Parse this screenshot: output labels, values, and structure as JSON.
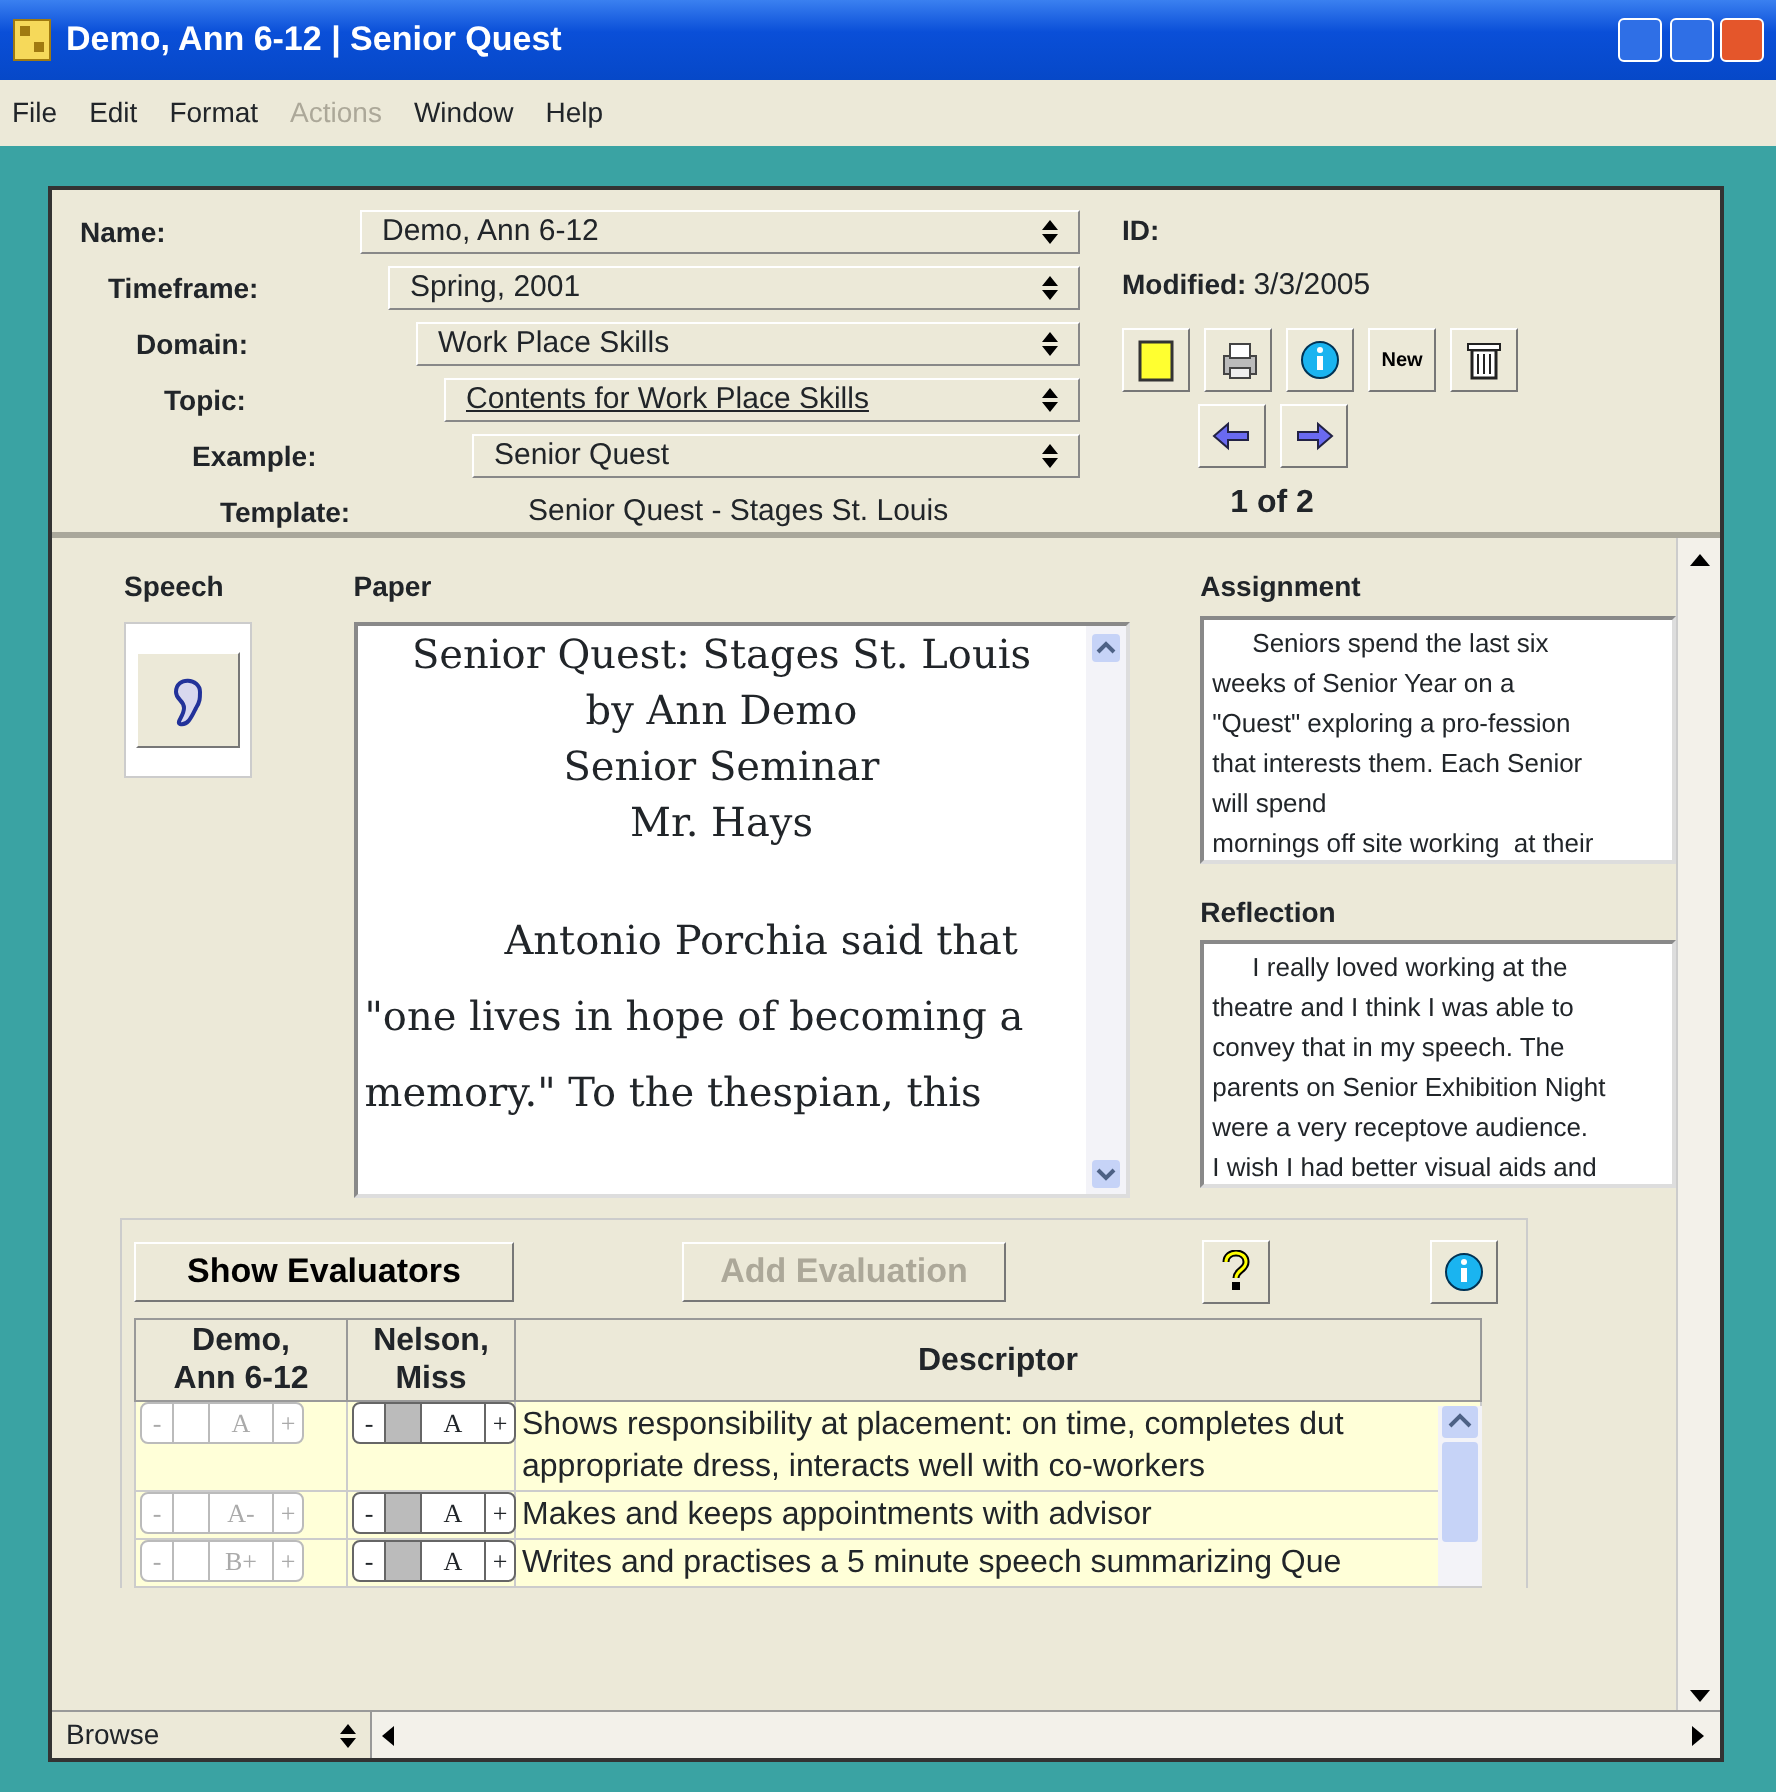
{
  "window": {
    "title": "Demo, Ann 6-12 | Senior Quest"
  },
  "menu": [
    {
      "label": "File",
      "disabled": false
    },
    {
      "label": "Edit",
      "disabled": false
    },
    {
      "label": "Format",
      "disabled": false
    },
    {
      "label": "Actions",
      "disabled": true
    },
    {
      "label": "Window",
      "disabled": false
    },
    {
      "label": "Help",
      "disabled": false
    }
  ],
  "fields": [
    {
      "label": "Name:",
      "value": "Demo, Ann 6-12",
      "kind": "select",
      "underlined": false
    },
    {
      "label": "Timeframe:",
      "value": "Spring, 2001",
      "kind": "select",
      "underlined": false
    },
    {
      "label": "Domain:",
      "value": "Work Place Skills",
      "kind": "select",
      "underlined": false
    },
    {
      "label": "Topic:",
      "value": "Contents for Work Place Skills",
      "kind": "select",
      "underlined": true
    },
    {
      "label": "Example:",
      "value": "Senior Quest",
      "kind": "select",
      "underlined": false
    },
    {
      "label": "Template:",
      "value": "Senior Quest - Stages St. Louis",
      "kind": "text",
      "underlined": false
    }
  ],
  "id": {
    "label": "ID:"
  },
  "modified": {
    "label": "Modified:",
    "value": "3/3/2005"
  },
  "toolbar": [
    {
      "kind": "notebook"
    },
    {
      "kind": "printer"
    },
    {
      "kind": "info"
    },
    {
      "kind": "text",
      "label": "New"
    },
    {
      "kind": "trash"
    }
  ],
  "record_counter": "1 of 2",
  "speech": {
    "label": "Speech"
  },
  "paper": {
    "label": "Paper",
    "heading": [
      "Senior Quest: Stages St. Louis",
      "by Ann Demo",
      "Senior Seminar",
      "Mr. Hays"
    ],
    "body": [
      "Antonio Porchia said that",
      "\"one lives in hope of becoming a",
      "memory.\" To the thespian, this"
    ]
  },
  "assignment": {
    "label": "Assignment",
    "lines": [
      "Seniors spend the last six",
      "weeks of Senior Year on a",
      "\"Quest\" exploring a pro-fession",
      "that interests them. Each Senior",
      "will spend",
      "mornings off site working  at their"
    ]
  },
  "reflection": {
    "label": "Reflection",
    "lines": [
      "I really loved working at the",
      "theatre and I think I was able to",
      "convey that in my speech. The",
      "parents on Senior Exhibition Night",
      "were a very receptove audience.",
      "I wish I had better visual aids and"
    ]
  },
  "evaluation": {
    "buttons": [
      {
        "label": "Show Evaluators",
        "disabled": false
      },
      {
        "label": "Add Evaluation",
        "disabled": true
      }
    ],
    "table": {
      "columns": [
        {
          "label": "Demo,\nAnn 6-12",
          "disabled": true
        },
        {
          "label": "Nelson,\nMiss",
          "disabled": false
        },
        {
          "label": "Descriptor"
        }
      ],
      "rows": [
        {
          "grades": [
            {
              "minus": "-",
              "grade": "A",
              "plus": "+"
            },
            {
              "minus": "-",
              "grade": "A",
              "plus": "+"
            }
          ],
          "descriptor": "Shows responsibility at placement: on time, completes dut\nappropriate dress, interacts well with co-workers"
        },
        {
          "grades": [
            {
              "minus": "-",
              "grade": "A-",
              "plus": "+"
            },
            {
              "minus": "-",
              "grade": "A",
              "plus": "+"
            }
          ],
          "descriptor": "Makes and keeps appointments with advisor"
        },
        {
          "grades": [
            {
              "minus": "-",
              "grade": "B+",
              "plus": "+"
            },
            {
              "minus": "-",
              "grade": "A",
              "plus": "+"
            }
          ],
          "descriptor": "Writes and practises a 5 minute speech summarizing Que"
        }
      ]
    }
  },
  "status_bar": {
    "mode": "Browse"
  }
}
